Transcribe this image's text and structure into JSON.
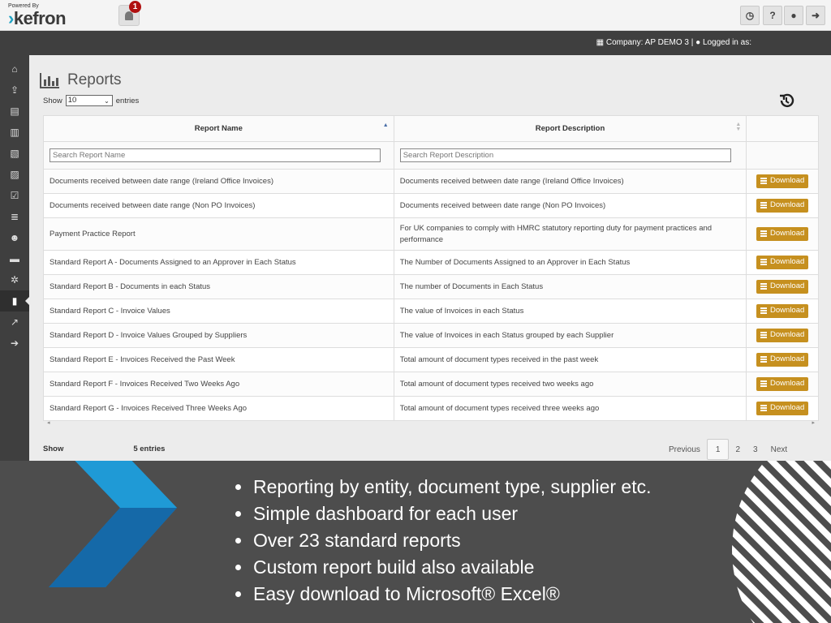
{
  "topbar": {
    "powered_by": "Powered By",
    "logo_text": "kefron",
    "notification_count": "1",
    "buttons": [
      "clock-icon",
      "help-icon",
      "user-icon",
      "logout-icon"
    ]
  },
  "header": {
    "company": "Company: AP DEMO 3 | ",
    "logged_in": "Logged in as:"
  },
  "page": {
    "title": "Reports",
    "show_label": "Show",
    "show_value": "10",
    "entries_label": "entries"
  },
  "table": {
    "columns": [
      "Report Name",
      "Report Description",
      ""
    ],
    "search_name_placeholder": "Search Report Name",
    "search_desc_placeholder": "Search Report Description",
    "download_label": "Download",
    "rows": [
      {
        "name": "Documents received between date range (Ireland Office Invoices)",
        "description": "Documents received between date range (Ireland Office Invoices)"
      },
      {
        "name": "Documents received between date range (Non PO Invoices)",
        "description": "Documents received between date range (Non PO Invoices)"
      },
      {
        "name": "Payment Practice Report",
        "description": "For UK companies to comply with HMRC statutory reporting duty for payment practices and performance"
      },
      {
        "name": "Standard Report A - Documents Assigned to an Approver in Each Status",
        "description": "The Number of Documents Assigned to an Approver in Each Status"
      },
      {
        "name": "Standard Report B - Documents in each Status",
        "description": "The number of Documents in Each Status"
      },
      {
        "name": "Standard Report C - Invoice Values",
        "description": "The value of Invoices in each Status"
      },
      {
        "name": "Standard Report D - Invoice Values Grouped by Suppliers",
        "description": "The value of Invoices in each Status grouped by each Supplier"
      },
      {
        "name": "Standard Report E - Invoices Received the Past Week",
        "description": "Total amount of document types received in the past week"
      },
      {
        "name": "Standard Report F - Invoices Received Two Weeks Ago",
        "description": "Total amount of document types received two weeks ago"
      },
      {
        "name": "Standard Report G - Invoices Received Three Weeks Ago",
        "description": "Total amount of document types received three weeks ago"
      }
    ]
  },
  "footer": {
    "showing_prefix": "Show",
    "showing_suffix": "5 entries",
    "pagination": {
      "previous": "Previous",
      "pages": [
        "1",
        "2",
        "3"
      ],
      "next": "Next"
    }
  },
  "sidebar": {
    "items": [
      "home-icon",
      "upload-icon",
      "document-icon",
      "document-lines-icon",
      "pdf-icon",
      "pdf-alt-icon",
      "checklist-icon",
      "database-icon",
      "users-icon",
      "briefcase-icon",
      "settings-icon",
      "reports-icon",
      "trend-icon",
      "arrow-right-icon"
    ]
  },
  "banner": {
    "bullets": [
      "Reporting by entity, document type, supplier etc.",
      "Simple dashboard for each user",
      "Over 23 standard reports",
      "Custom report build also available",
      "Easy download to Microsoft® Excel®"
    ]
  },
  "colors": {
    "accent": "#c6901f",
    "sidebar": "#3f3f3f",
    "badge": "#b01010",
    "banner": "#4d4d4d",
    "chevron_blue": "#1e7fc4"
  }
}
